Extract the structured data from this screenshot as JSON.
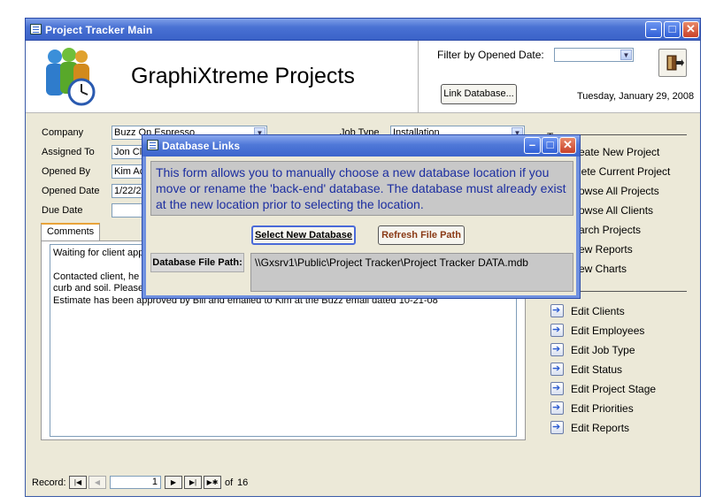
{
  "window": {
    "title": "Project Tracker Main"
  },
  "header": {
    "app_title": "GraphiXtreme Projects",
    "filter_label": "Filter by Opened Date:",
    "filter_value": "",
    "link_db_label": "Link Database...",
    "date": "Tuesday, January 29, 2008"
  },
  "form": {
    "company_label": "Company",
    "company_value": "Buzz On Espresso",
    "assigned_label": "Assigned To",
    "assigned_value": "Jon Cle",
    "opened_by_label": "Opened By",
    "opened_by_value": "Kim Ac",
    "opened_date_label": "Opened Date",
    "opened_date_value": "1/22/2",
    "due_date_label": "Due Date",
    "due_date_value": "",
    "job_type_label": "Job Type",
    "job_type_value": "Installation",
    "comments_tab": "Comments",
    "comments_lines": [
      "Waiting for client app",
      "",
      "Contacted client, he",
      "curb and soil. Please",
      "Estimate has been approved by Bill and emailed to Kim at the Buzz email dated 10-21-08"
    ]
  },
  "right_panel": {
    "top_partial": "T",
    "links": [
      "eate New Project",
      "lete Current Project",
      "owse All Projects",
      "owse All Clients",
      "arch Projects",
      "ew Reports",
      "ew Charts"
    ],
    "edit_items": [
      "Edit Clients",
      "Edit Employees",
      "Edit Job Type",
      "Edit Status",
      "Edit Project Stage",
      "Edit Priorities",
      "Edit Reports"
    ]
  },
  "record_nav": {
    "label": "Record:",
    "current": "1",
    "of_label": "of",
    "total": "16"
  },
  "dialog": {
    "title": "Database Links",
    "message": "This form allows you to manually choose a new database location if you move or rename the 'back-end' database.  The database must already exist at the new location prior to selecting the location.",
    "select_label": "Select New Database",
    "refresh_label": "Refresh File Path",
    "path_label": "Database File Path:",
    "path_value": "\\\\Gxsrv1\\Public\\Project Tracker\\Project Tracker DATA.mdb"
  }
}
